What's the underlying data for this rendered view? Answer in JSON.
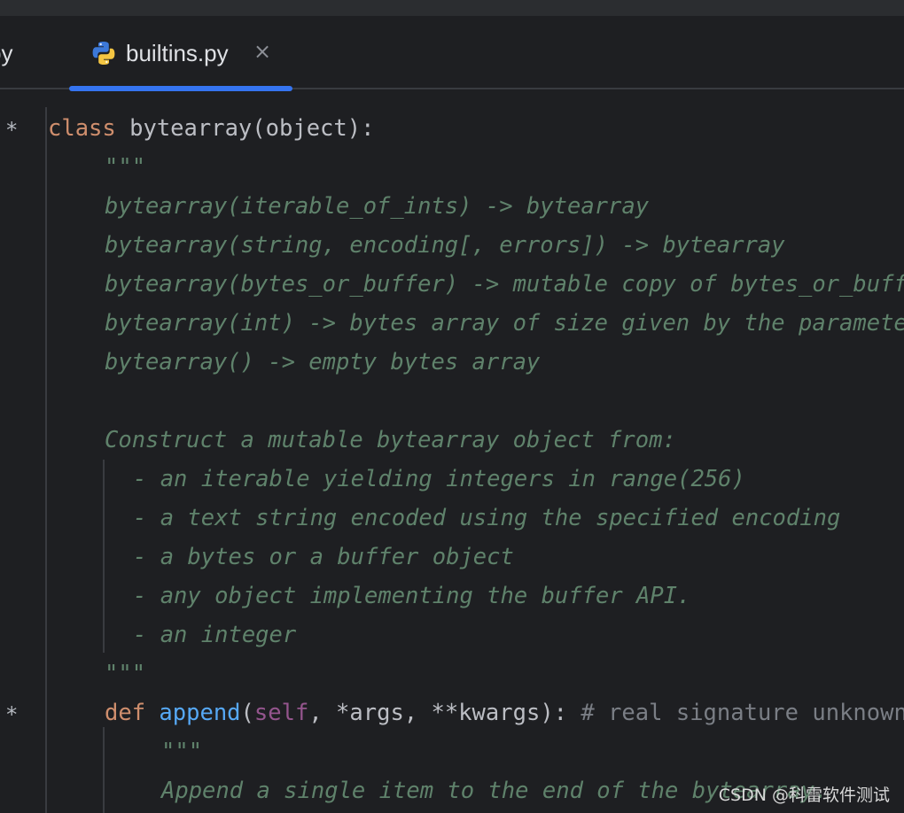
{
  "tabs": {
    "previous_tab_label": "py",
    "active_tab_label": "builtins.py",
    "close_symbol": "×",
    "active_icon": "python-file-icon"
  },
  "gutter": {
    "fold_marker_1": "*",
    "fold_marker_2": "*"
  },
  "code": {
    "l1_kw": "class",
    "l1_rest": " bytearray(object):",
    "l2": "\"\"\"",
    "l3": "bytearray(iterable_of_ints) -> bytearray",
    "l4": "bytearray(string, encoding[, errors]) -> bytearray",
    "l5": "bytearray(bytes_or_buffer) -> mutable copy of bytes_or_buffer",
    "l6": "bytearray(int) -> bytes array of size given by the parameter initialized with null bytes",
    "l7": "bytearray() -> empty bytes array",
    "l9": "Construct a mutable bytearray object from:",
    "l10": "- an iterable yielding integers in range(256)",
    "l11": "- a text string encoded using the specified encoding",
    "l12": "- a bytes or a buffer object",
    "l13": "- any object implementing the buffer API.",
    "l14": "- an integer",
    "l15": "\"\"\"",
    "l16_kw": "def",
    "l16_fn": "append",
    "l16_open": "(",
    "l16_self": "self",
    "l16_rest": ", *args, **kwargs): ",
    "l16_comment": "# real signature unknown",
    "l17": "\"\"\"",
    "l18": "Append a single item to the end of the bytearray."
  },
  "watermark": "CSDN @科雷软件测试",
  "colors": {
    "editor_bg": "#1e1f22",
    "keyword": "#cf8e6d",
    "docstring": "#5f826b",
    "function": "#56a8f5",
    "self": "#94558d",
    "comment": "#7a7e85",
    "accent": "#3574f0"
  }
}
